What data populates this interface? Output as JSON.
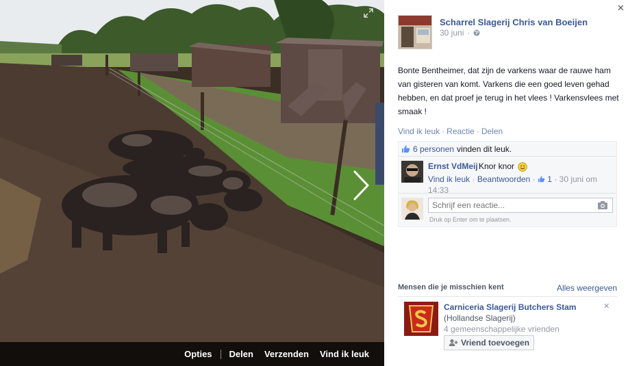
{
  "viewer": {
    "actions": [
      "Opties",
      "Delen",
      "Verzenden",
      "Vind ik leuk"
    ],
    "icons": {
      "expand": "expand-icon",
      "next": "chevron-right-icon"
    }
  },
  "post": {
    "page_name": "Scharrel Slagerij Chris van Boeijen",
    "date": "30 juni",
    "privacy_icon": "globe-icon",
    "text": "Bonte Bentheimer, dat zijn de varkens waar de rauwe ham van gisteren van komt. Varkens die een goed leven gehad hebben, en dat proef je terug in het vlees ! Varkensvlees met smaak !",
    "actions": {
      "like": "Vind ik leuk",
      "comment": "Reactie",
      "share": "Delen"
    }
  },
  "likes": {
    "count_text": "6 personen",
    "suffix": "vinden dit leuk."
  },
  "comment": {
    "author": "Ernst VdMeij",
    "text": "Knor knor",
    "like": "Vind ik leuk",
    "reply": "Beantwoorden",
    "like_count": "1",
    "timestamp": "30 juni om 14:33"
  },
  "composer": {
    "placeholder": "Schrijf een reactie...",
    "hint": "Druk op Enter om te plaatsen."
  },
  "pymk": {
    "title": "Mensen die je misschien kent",
    "see_all": "Alles weergeven",
    "suggestion": {
      "name": "Carniceria Slagerij Butchers Stam",
      "category": "(Hollandse Slagerij)",
      "mutual": "4 gemeenschappelijke vrienden",
      "add_label": "Vriend toevoegen"
    }
  },
  "colors": {
    "link": "#3b5998",
    "muted": "#9197a3",
    "bar": "#000000"
  }
}
